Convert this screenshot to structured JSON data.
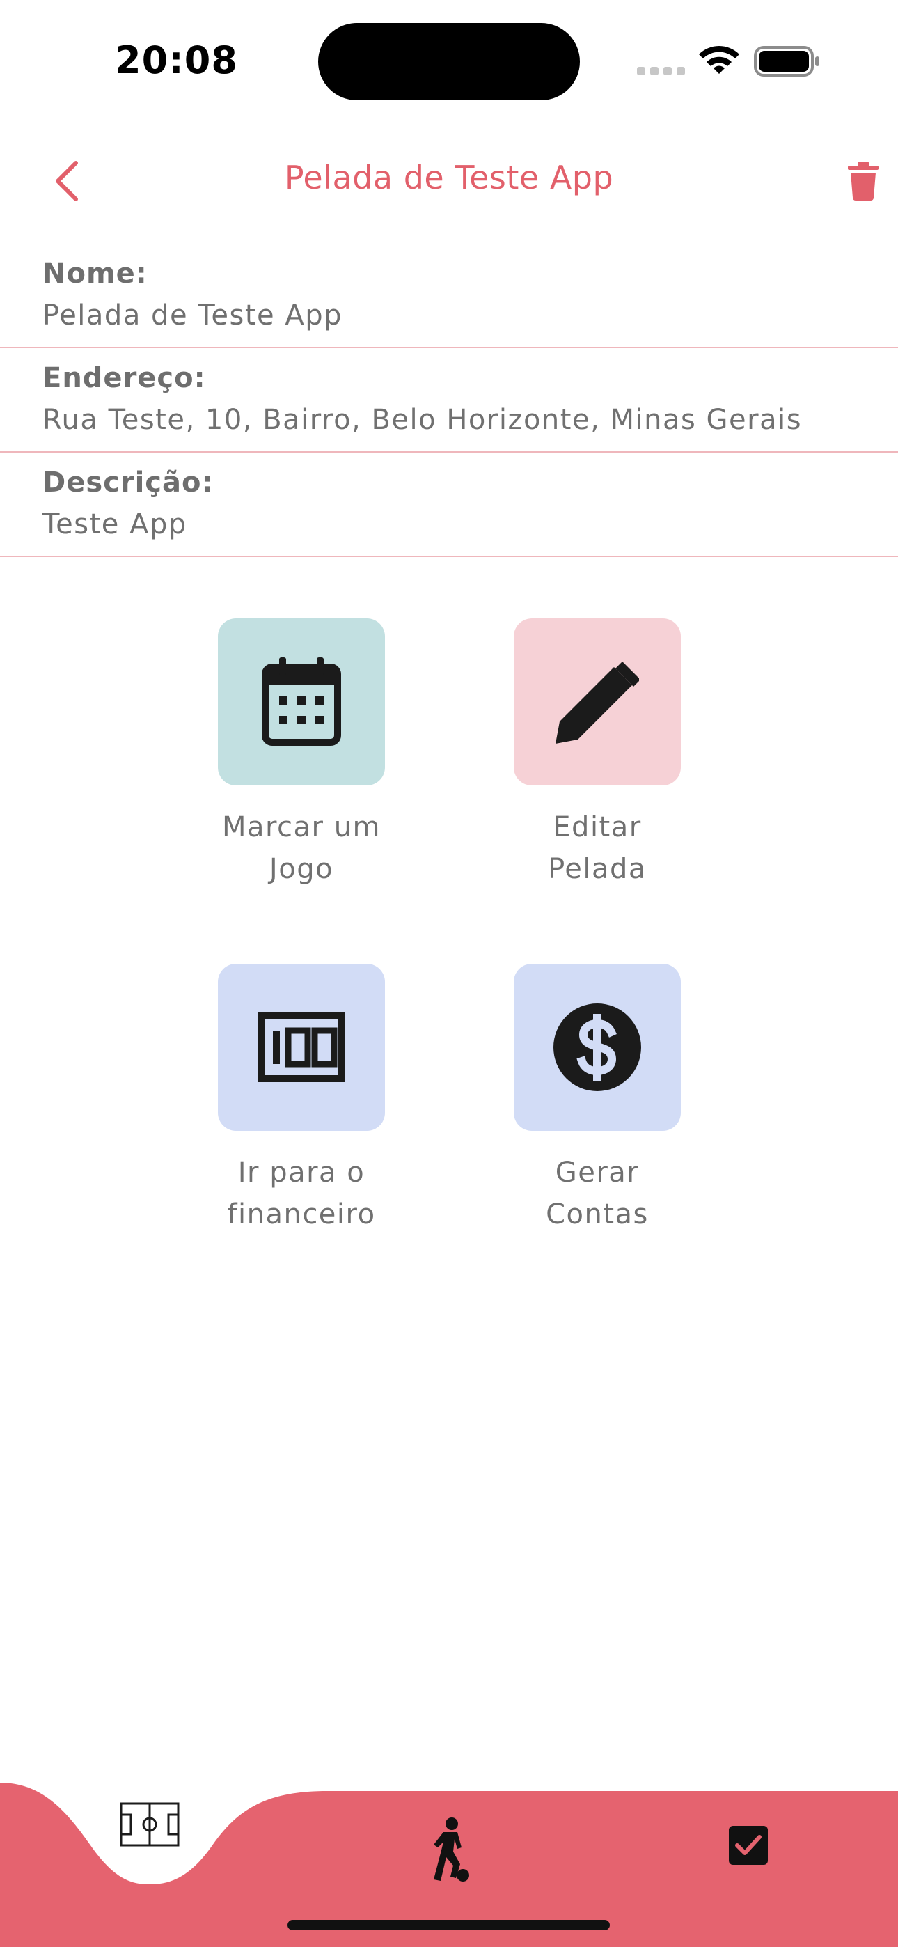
{
  "status_bar": {
    "time": "20:08"
  },
  "header": {
    "title": "Pelada de Teste App",
    "back_icon": "chevron-left-icon",
    "delete_icon": "trash-icon"
  },
  "fields": [
    {
      "label": "Nome:",
      "value": "Pelada de Teste App"
    },
    {
      "label": "Endereço:",
      "value": "Rua Teste, 10, Bairro, Belo Horizonte, Minas Gerais"
    },
    {
      "label": "Descrição:",
      "value": "Teste App"
    }
  ],
  "actions": [
    {
      "line1": "Marcar um",
      "line2": "Jogo",
      "icon": "calendar-icon",
      "color": "#c2e0e1"
    },
    {
      "line1": "Editar",
      "line2": "Pelada",
      "icon": "pencil-icon",
      "color": "#f6d1d6"
    },
    {
      "line1": "Ir para o",
      "line2": "financeiro",
      "icon": "scoreboard-100-icon",
      "color": "#d2dcf6"
    },
    {
      "line1": "Gerar",
      "line2": "Contas",
      "icon": "dollar-circle-icon",
      "color": "#d2dcf6"
    }
  ],
  "bottom_nav": {
    "background": "#e5636f",
    "items": [
      {
        "icon": "soccer-field-icon",
        "active": true
      },
      {
        "icon": "soccer-player-icon",
        "active": false
      },
      {
        "icon": "checkbox-icon",
        "active": false
      }
    ]
  },
  "colors": {
    "accent": "#e2606b",
    "divider": "#efb7bc",
    "text": "#707070"
  }
}
